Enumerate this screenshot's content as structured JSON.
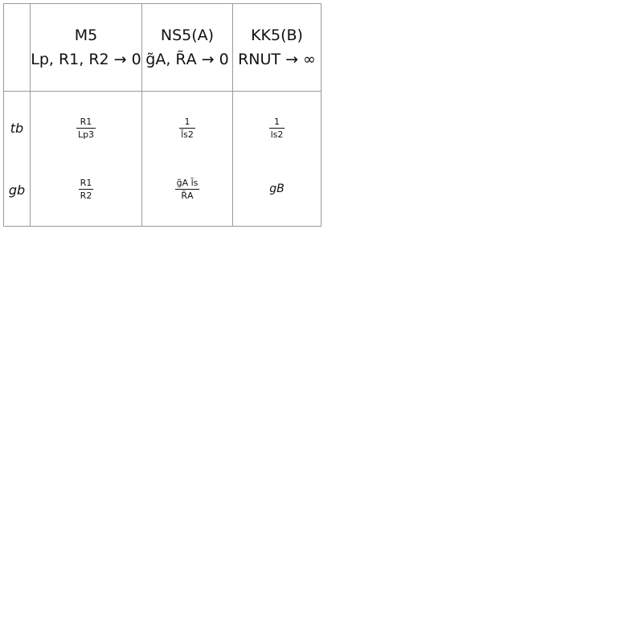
{
  "table": {
    "columns": [
      {
        "title": "M5",
        "limit": "Lp, R1, R2 → 0"
      },
      {
        "title": "NS5(A)",
        "limit": "g̃A, R̃A → 0"
      },
      {
        "title": "KK5(B)",
        "limit": "RNUT → ∞"
      }
    ],
    "rows": [
      {
        "label": "tb",
        "cells": [
          {
            "num": "R1",
            "den": "Lp3"
          },
          {
            "num": "1",
            "den": "l̃s2"
          },
          {
            "num": "1",
            "den": "ls2"
          }
        ]
      },
      {
        "label": "gb",
        "cells": [
          {
            "num": "R1",
            "den": "R2"
          },
          {
            "num": "g̃A l̃s",
            "den": "R̃A"
          },
          {
            "plain": "gB"
          }
        ]
      }
    ]
  }
}
